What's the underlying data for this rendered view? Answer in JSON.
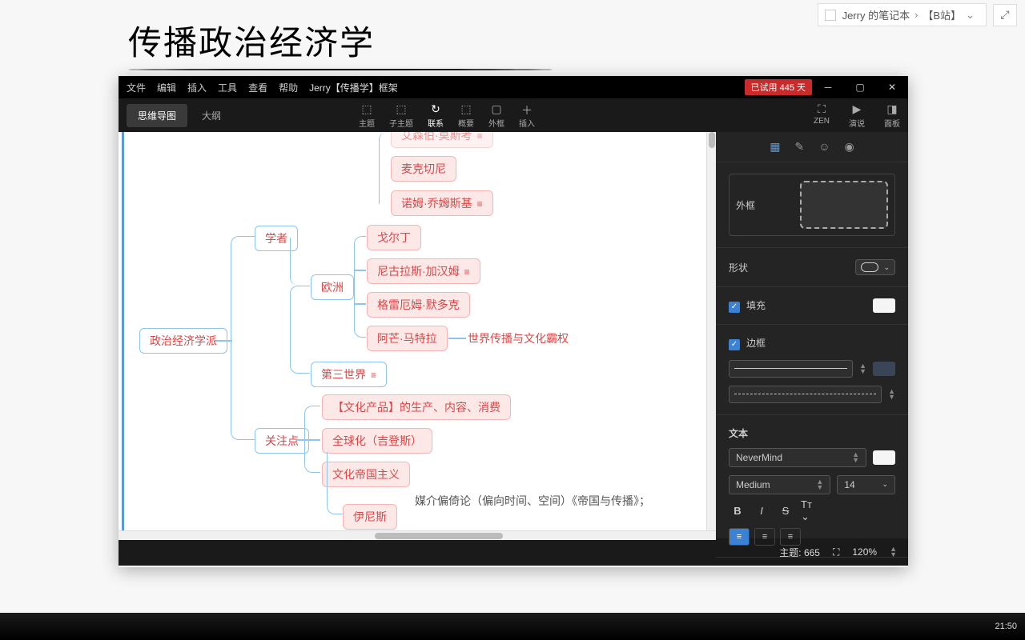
{
  "breadcrumb": {
    "notebook": "Jerry 的笔记本",
    "section": "【B站】"
  },
  "handwriting": "传播政治经济学",
  "menubar": {
    "file": "文件",
    "edit": "编辑",
    "insert": "插入",
    "tools": "工具",
    "view": "查看",
    "help": "帮助",
    "doc": "Jerry【传播学】框架",
    "trial": "已试用 445 天"
  },
  "toolbar": {
    "views": {
      "mindmap": "思维导图",
      "outline": "大纲"
    },
    "tools": {
      "topic": "主题",
      "subtopic": "子主题",
      "relation": "联系",
      "summary": "概要",
      "boundary": "外框",
      "insert": "插入"
    },
    "right": {
      "zen": "ZEN",
      "present": "演说",
      "panel": "面板"
    }
  },
  "mindmap": {
    "root": "政治经济学派",
    "scholar": "学者",
    "europe": "欧洲",
    "third_world": "第三世界",
    "focus": "关注点",
    "people": {
      "p1": "艾森伯·莫斯考",
      "p2": "麦克切尼",
      "p3": "诺姆·乔姆斯基",
      "p4": "戈尔丁",
      "p5": "尼古拉斯·加汉姆",
      "p6": "格雷厄姆·默多克",
      "p7": "阿芒·马特拉",
      "p7detail": "世界传播与文化霸权",
      "innis": "伊尼斯",
      "innis_detail": "媒介偏倚论（偏向时间、空间）《帝国与传播》；"
    },
    "focus_items": {
      "f1": "【文化产品】的生产、内容、消费",
      "f2": "全球化（吉登斯）",
      "f3": "文化帝国主义"
    }
  },
  "panel": {
    "boundary_label": "外框",
    "shape": "形状",
    "fill": "填充",
    "border": "边框",
    "text": "文本",
    "font": "NeverMind",
    "weight": "Medium",
    "size": "14"
  },
  "status": {
    "topics_label": "主题:",
    "topics": "665",
    "zoom": "120%"
  },
  "taskbar": {
    "time": "21:50"
  }
}
